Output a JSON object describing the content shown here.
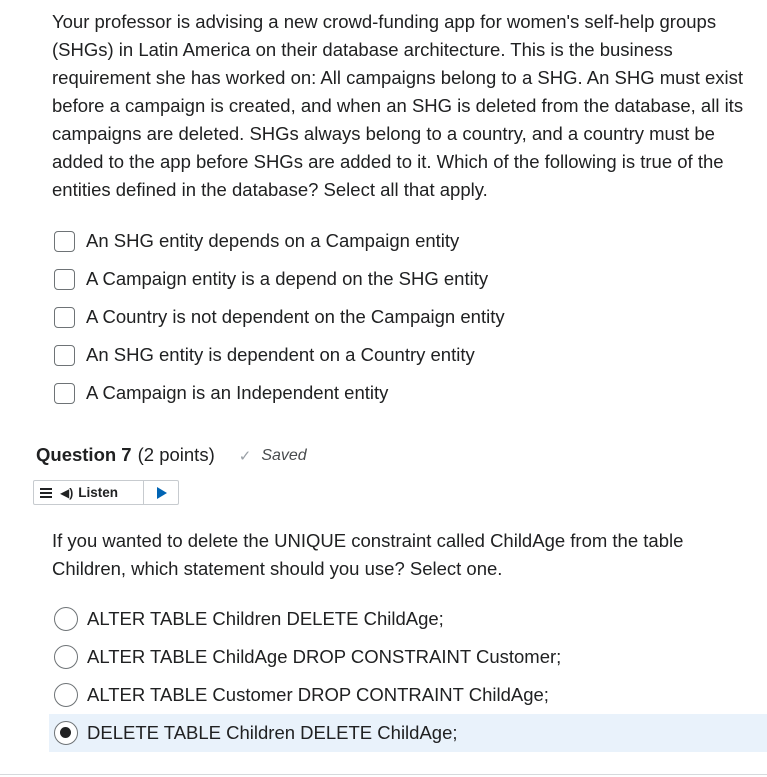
{
  "question6": {
    "prompt": "Your professor is advising a new crowd-funding app for women's self-help groups (SHGs) in Latin America on their database architecture. This is the business requirement she has worked on: All campaigns belong to a SHG. An SHG must exist before a campaign is created, and when an SHG is deleted from the database, all its campaigns are deleted. SHGs always belong to a country, and a country must be added to the app before SHGs are added to it. Which of the following is true of the entities defined in the database? Select all that apply.",
    "options": [
      {
        "label": "An SHG entity depends on a Campaign entity",
        "checked": false
      },
      {
        "label": "A Campaign entity is a depend on the SHG entity",
        "checked": false
      },
      {
        "label": "A Country is not dependent on the Campaign entity",
        "checked": false
      },
      {
        "label": "An SHG entity is dependent on a Country entity",
        "checked": false
      },
      {
        "label": "A Campaign is an Independent entity",
        "checked": false
      }
    ]
  },
  "question7": {
    "title": "Question 7",
    "points": "(2 points)",
    "saved_label": "Saved",
    "listen_label": "Listen",
    "prompt": "If you wanted to delete the UNIQUE constraint called ChildAge from the table Children, which statement should you use? Select one.",
    "options": [
      {
        "label": "ALTER TABLE Children DELETE ChildAge;",
        "selected": false
      },
      {
        "label": "ALTER TABLE ChildAge DROP CONSTRAINT Customer;",
        "selected": false
      },
      {
        "label": "ALTER TABLE Customer DROP CONTRAINT ChildAge;",
        "selected": false
      },
      {
        "label": "DELETE TABLE Children DELETE ChildAge;",
        "selected": true
      }
    ]
  },
  "icons": {
    "saved": "checkmark-icon",
    "listen_menu": "menu-icon",
    "listen_speaker": "speaker-icon",
    "play": "play-icon"
  },
  "colors": {
    "text": "#202122",
    "selected_row_bg": "#e9f2fb",
    "play_accent": "#0064b4"
  }
}
